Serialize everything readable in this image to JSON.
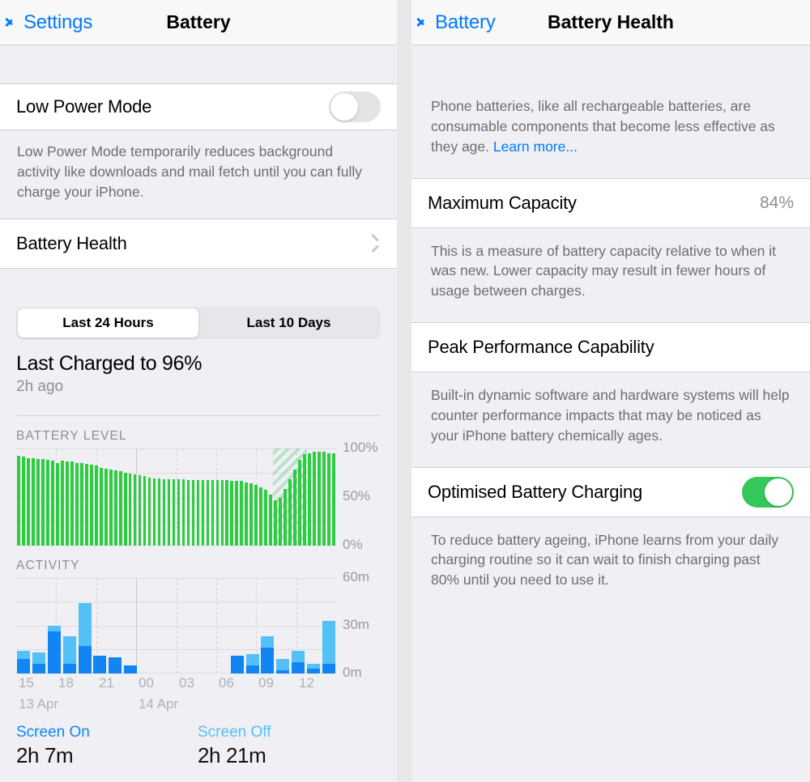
{
  "left_panel": {
    "nav": {
      "back_label": "Settings",
      "title": "Battery",
      "back_icon": "chevron-left-icon"
    },
    "low_power_mode": {
      "label": "Low Power Mode",
      "toggle_state": "off",
      "footnote": "Low Power Mode temporarily reduces background activity like downloads and mail fetch until you can fully charge your iPhone."
    },
    "battery_health_row": {
      "label": "Battery Health",
      "disclosure_icon": "chevron-right-icon"
    },
    "segmented": {
      "options": [
        "Last 24 Hours",
        "Last 10 Days"
      ],
      "selected": "Last 24 Hours"
    },
    "charge_summary": {
      "title": "Last Charged to 96%",
      "subtitle": "2h ago"
    },
    "battery_chart_label": "BATTERY LEVEL",
    "activity_chart_label": "ACTIVITY",
    "legend": [
      {
        "name": "Screen On",
        "value": "2h 7m",
        "color": "#1186f3"
      },
      {
        "name": "Screen Off",
        "value": "2h 21m",
        "color": "#53c1f7"
      }
    ]
  },
  "right_panel": {
    "nav": {
      "back_label": "Battery",
      "title": "Battery Health",
      "back_icon": "chevron-left-icon"
    },
    "intro": {
      "text": "Phone batteries, like all rechargeable batteries, are consumable components that become less effective as they age. ",
      "link": "Learn more..."
    },
    "maximum_capacity": {
      "label": "Maximum Capacity",
      "value": "84%",
      "footnote": "This is a measure of battery capacity relative to when it was new. Lower capacity may result in fewer hours of usage between charges."
    },
    "peak_performance": {
      "label": "Peak Performance Capability",
      "footnote": "Built-in dynamic software and hardware systems will help counter performance impacts that may be noticed as your iPhone battery chemically ages."
    },
    "optimised_charging": {
      "label": "Optimised Battery Charging",
      "toggle_state": "on",
      "footnote": "To reduce battery ageing, iPhone learns from your daily charging routine so it can wait to finish charging past 80% until you need to use it."
    }
  },
  "chart_data": [
    {
      "type": "bar",
      "title": "BATTERY LEVEL",
      "xlabel": "",
      "ylabel": "",
      "ylim": [
        0,
        100
      ],
      "ytick_labels": [
        "100%",
        "50%",
        "0%"
      ],
      "ytick_values": [
        100,
        50,
        0
      ],
      "grid": true,
      "series_color": "#2ecc40",
      "charging_band": {
        "start_index": 53,
        "end_index": 59,
        "label": "charging"
      },
      "values": [
        92,
        91,
        90,
        90,
        89,
        89,
        88,
        87,
        85,
        87,
        86,
        86,
        85,
        85,
        84,
        83,
        82,
        80,
        79,
        78,
        77,
        76,
        75,
        74,
        73,
        72,
        71,
        70,
        69,
        69,
        68,
        68,
        68,
        68,
        68,
        67,
        67,
        67,
        67,
        67,
        67,
        67,
        67,
        67,
        66,
        66,
        66,
        65,
        64,
        62,
        60,
        57,
        52,
        46,
        49,
        58,
        68,
        78,
        88,
        94,
        95,
        96,
        96,
        96,
        95,
        95
      ]
    },
    {
      "type": "bar",
      "title": "ACTIVITY",
      "xlabel": "",
      "ylabel": "",
      "ylim": [
        0,
        60
      ],
      "ytick_labels": [
        "60m",
        "30m",
        "0m"
      ],
      "ytick_values": [
        60,
        30,
        0
      ],
      "grid": true,
      "stacked": true,
      "x_tick_labels": [
        "15",
        "18",
        "21",
        "00",
        "03",
        "06",
        "09",
        "12"
      ],
      "x_date_labels": [
        {
          "label": "13 Apr",
          "at_tick": "15"
        },
        {
          "label": "14 Apr",
          "at_tick": "00"
        }
      ],
      "series": [
        {
          "name": "Screen On",
          "color": "#1186f3",
          "values": [
            9,
            6,
            26,
            6,
            17,
            11,
            10,
            5,
            0,
            0,
            0,
            0,
            0,
            0,
            11,
            5,
            16,
            2,
            7,
            3,
            6
          ]
        },
        {
          "name": "Screen Off",
          "color": "#53c1f7",
          "values": [
            5,
            7,
            4,
            17,
            27,
            0,
            0,
            0,
            0,
            0,
            0,
            0,
            0,
            0,
            0,
            7,
            7,
            7,
            7,
            3,
            27
          ]
        }
      ],
      "totals_legend": [
        {
          "name": "Screen On",
          "value": "2h 7m"
        },
        {
          "name": "Screen Off",
          "value": "2h 21m"
        }
      ]
    }
  ]
}
